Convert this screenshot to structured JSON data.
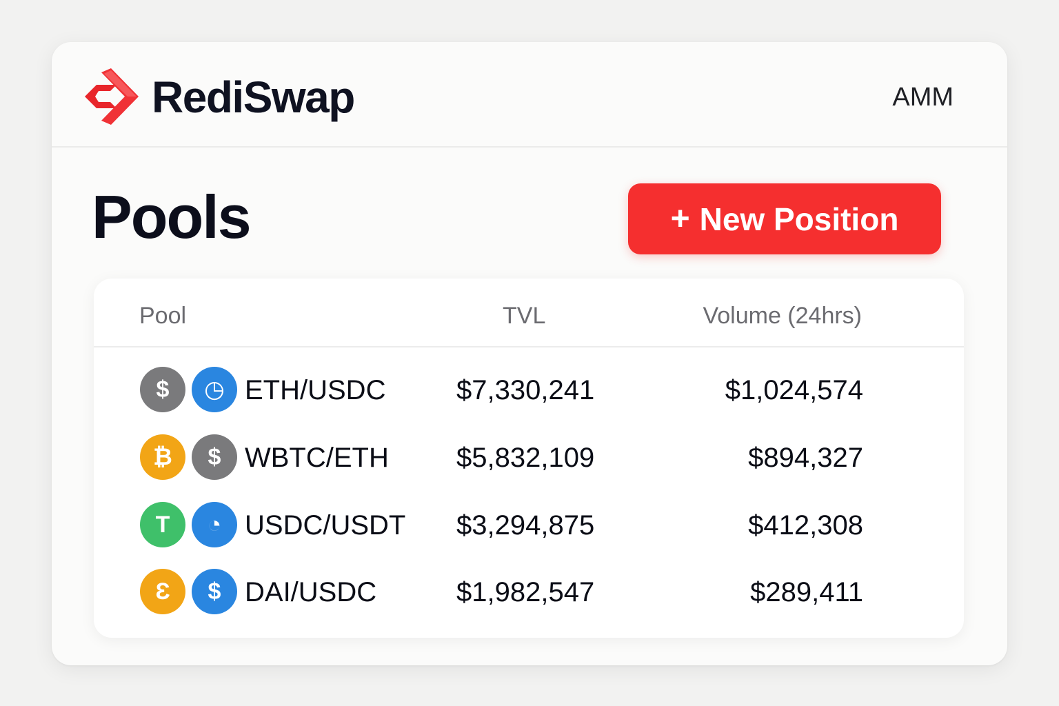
{
  "header": {
    "brand": "RediSwap",
    "mode": "AMM"
  },
  "page": {
    "title": "Pools",
    "new_position": {
      "icon_glyph": "+",
      "label": "New Position"
    }
  },
  "table": {
    "columns": [
      "Pool",
      "TVL",
      "Volume (24hrs)"
    ],
    "rows": [
      {
        "pair": "ETH/USDC",
        "tvl": "$7,330,241",
        "volume": "$1,024,574",
        "icons": [
          {
            "name": "dollar-coin-icon",
            "glyph": "$",
            "color": "#7a7a7c"
          },
          {
            "name": "swirl-coin-icon",
            "glyph": "◷",
            "color": "#2a86e0"
          }
        ]
      },
      {
        "pair": "WBTC/ETH",
        "tvl": "$5,832,109",
        "volume": "$894,327",
        "icons": [
          {
            "name": "bitcoin-coin-icon",
            "glyph": "₿",
            "color": "#f2a516"
          },
          {
            "name": "dollar-coin-icon",
            "glyph": "$",
            "color": "#7a7a7c"
          }
        ]
      },
      {
        "pair": "USDC/USDT",
        "tvl": "$3,294,875",
        "volume": "$412,308",
        "icons": [
          {
            "name": "tether-coin-icon",
            "glyph": "T",
            "color": "#3fc06a"
          },
          {
            "name": "swirl-coin-icon",
            "glyph": "◔",
            "color": "#2a86e0"
          }
        ]
      },
      {
        "pair": "DAI/USDC",
        "tvl": "$1,982,547",
        "volume": "$289,411",
        "icons": [
          {
            "name": "dai-coin-icon",
            "glyph": "Ɛ",
            "color": "#f2a516"
          },
          {
            "name": "usdc-coin-icon",
            "glyph": "$",
            "color": "#2a86e0"
          }
        ]
      }
    ]
  },
  "colors": {
    "accent": "#f52f2f",
    "text": "#0c0e1b",
    "muted": "#6b6b70"
  }
}
